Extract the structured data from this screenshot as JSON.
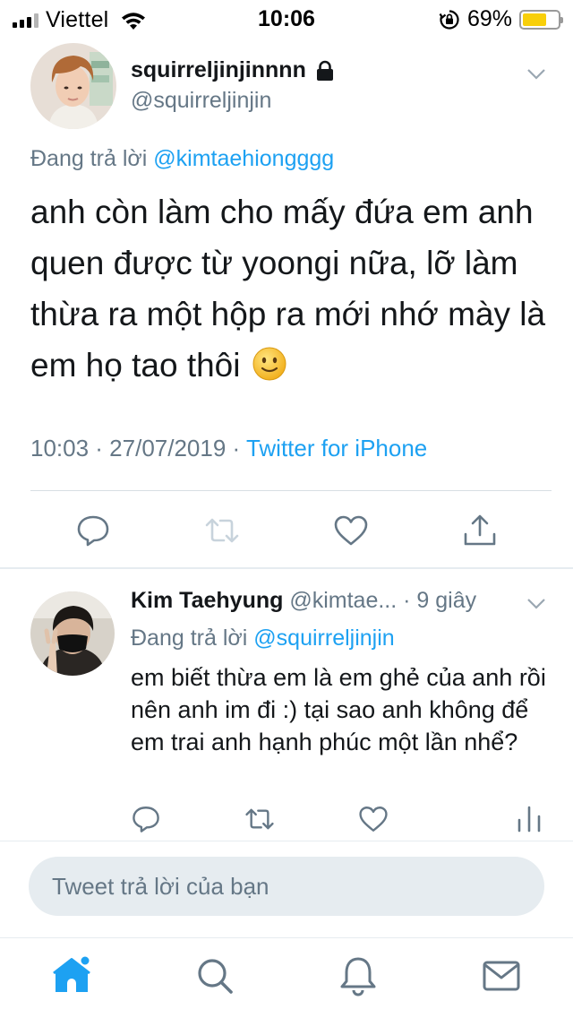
{
  "status_bar": {
    "carrier": "Viettel",
    "time": "10:06",
    "battery_percent": "69%",
    "battery_level": 0.69,
    "icons": [
      "signal-icon",
      "wifi-icon",
      "orientation-lock-icon",
      "battery-icon"
    ]
  },
  "main_tweet": {
    "display_name": "squirreljinjinnnn",
    "handle": "@squirreljinjin",
    "protected_icon": "lock-icon",
    "replying_prefix": "Đang trả lời",
    "replying_mention": "@kimtaehiongggg",
    "text": "anh còn làm cho mấy đứa em anh quen được từ yoongi nữa, lỡ làm thừa ra một hộp ra mới nhớ mày là em họ tao thôi",
    "emoji": "slightly-smiling-face-icon",
    "timestamp": "10:03 · 27/07/2019 ·",
    "source": "Twitter for iPhone",
    "actions": [
      "reply-icon",
      "retweet-icon",
      "like-icon",
      "share-icon"
    ]
  },
  "reply_tweet": {
    "display_name": "Kim Taehyung",
    "handle_time": "@kimtae... · 9 giây",
    "replying_prefix": "Đang trả lời",
    "replying_mention": "@squirreljinjin",
    "text": "em biết thừa em là em ghẻ của anh rồi nên anh im đi :) tại sao anh không để em trai anh hạnh phúc một lần nhể?",
    "actions": [
      "reply-icon",
      "retweet-icon",
      "like-icon",
      "analytics-icon"
    ]
  },
  "compose": {
    "placeholder": "Tweet trả lời của bạn",
    "value": ""
  },
  "tab_bar": {
    "tabs": [
      "home-icon",
      "search-icon",
      "notifications-icon",
      "messages-icon"
    ],
    "active": "home-icon"
  },
  "colors": {
    "accent": "#1da1f2",
    "secondary_text": "#657786",
    "text": "#14171a",
    "compose_bg": "#e6ecf0",
    "battery": "#f8cf0a"
  }
}
